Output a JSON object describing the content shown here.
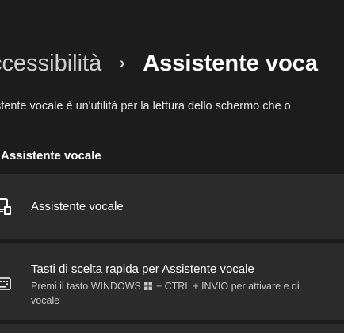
{
  "breadcrumb": {
    "parent": "ccessibilità",
    "separator": "›",
    "current": "Assistente voca"
  },
  "description": "stente vocale è un'utilità per la lettura dello schermo che o",
  "section": {
    "title": "Assistente vocale"
  },
  "cards": [
    {
      "label": "Assistente vocale",
      "icon": "narrator-icon"
    },
    {
      "label": "Tasti di scelta rapida per Assistente vocale",
      "sub_before": "Premi il tasto WINDOWS",
      "sub_after": "+ CTRL + INVIO per attivare e di",
      "sub_line2": "vocale",
      "icon": "keyboard-icon"
    }
  ],
  "colors": {
    "background": "#1c1c1c",
    "card": "#2b2b2b",
    "text": "#ffffff",
    "secondary_text": "#c5c5c5"
  }
}
